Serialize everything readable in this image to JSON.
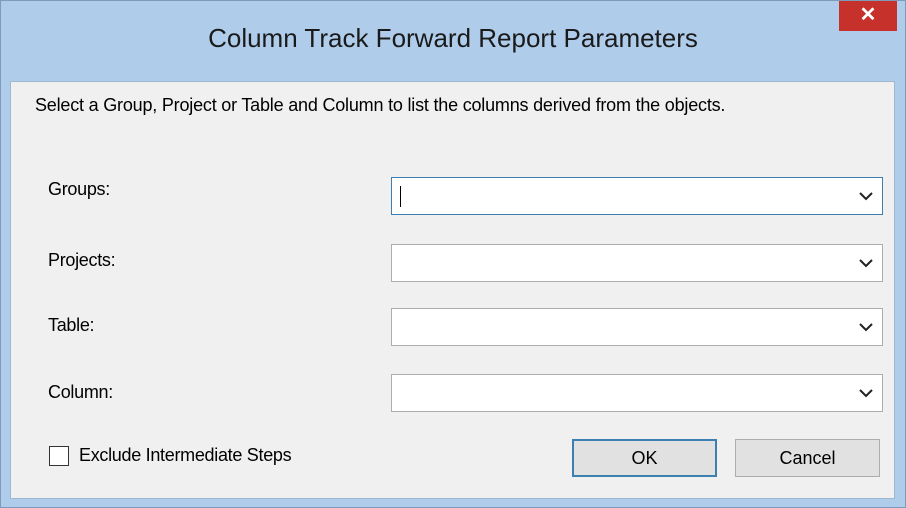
{
  "window": {
    "title": "Column Track Forward Report Parameters",
    "close_glyph": "✕"
  },
  "instruction": "Select a Group, Project or Table and Column to list the columns derived from the objects.",
  "fields": [
    {
      "label": "Groups:",
      "value": "",
      "focused": true
    },
    {
      "label": "Projects:",
      "value": ""
    },
    {
      "label": "Table:",
      "value": ""
    },
    {
      "label": "Column:",
      "value": ""
    }
  ],
  "exclude_checkbox": {
    "label": "Exclude Intermediate Steps",
    "checked": false
  },
  "buttons": {
    "ok": "OK",
    "cancel": "Cancel"
  },
  "colors": {
    "frame": "#afcdeb",
    "close": "#c7312b",
    "focus_border": "#3c7fb1"
  },
  "icons": {
    "close": "close-icon",
    "dropdown": "chevron-down-icon"
  }
}
